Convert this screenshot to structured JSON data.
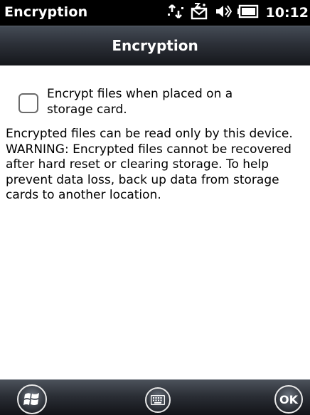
{
  "status_bar": {
    "app_title": "Encryption",
    "time": "10:12",
    "icons": [
      "connectivity-icon",
      "messaging-icon",
      "volume-icon",
      "battery-icon"
    ]
  },
  "header": {
    "title": "Encryption"
  },
  "content": {
    "checkbox_label": "Encrypt files when placed on a storage card.",
    "checkbox_checked": false,
    "description": "Encrypted files can be read only by this device. WARNING: Encrypted files cannot be recovered after hard reset or clearing storage. To help prevent data loss, back up data from storage cards to another location."
  },
  "bottom_bar": {
    "start_icon": "windows-logo-icon",
    "keyboard_icon": "keyboard-icon",
    "ok_label": "OK"
  },
  "colors": {
    "status_bar_bg": "#000000",
    "header_bg": "#2c3038",
    "text": "#000000",
    "header_text": "#ffffff"
  }
}
